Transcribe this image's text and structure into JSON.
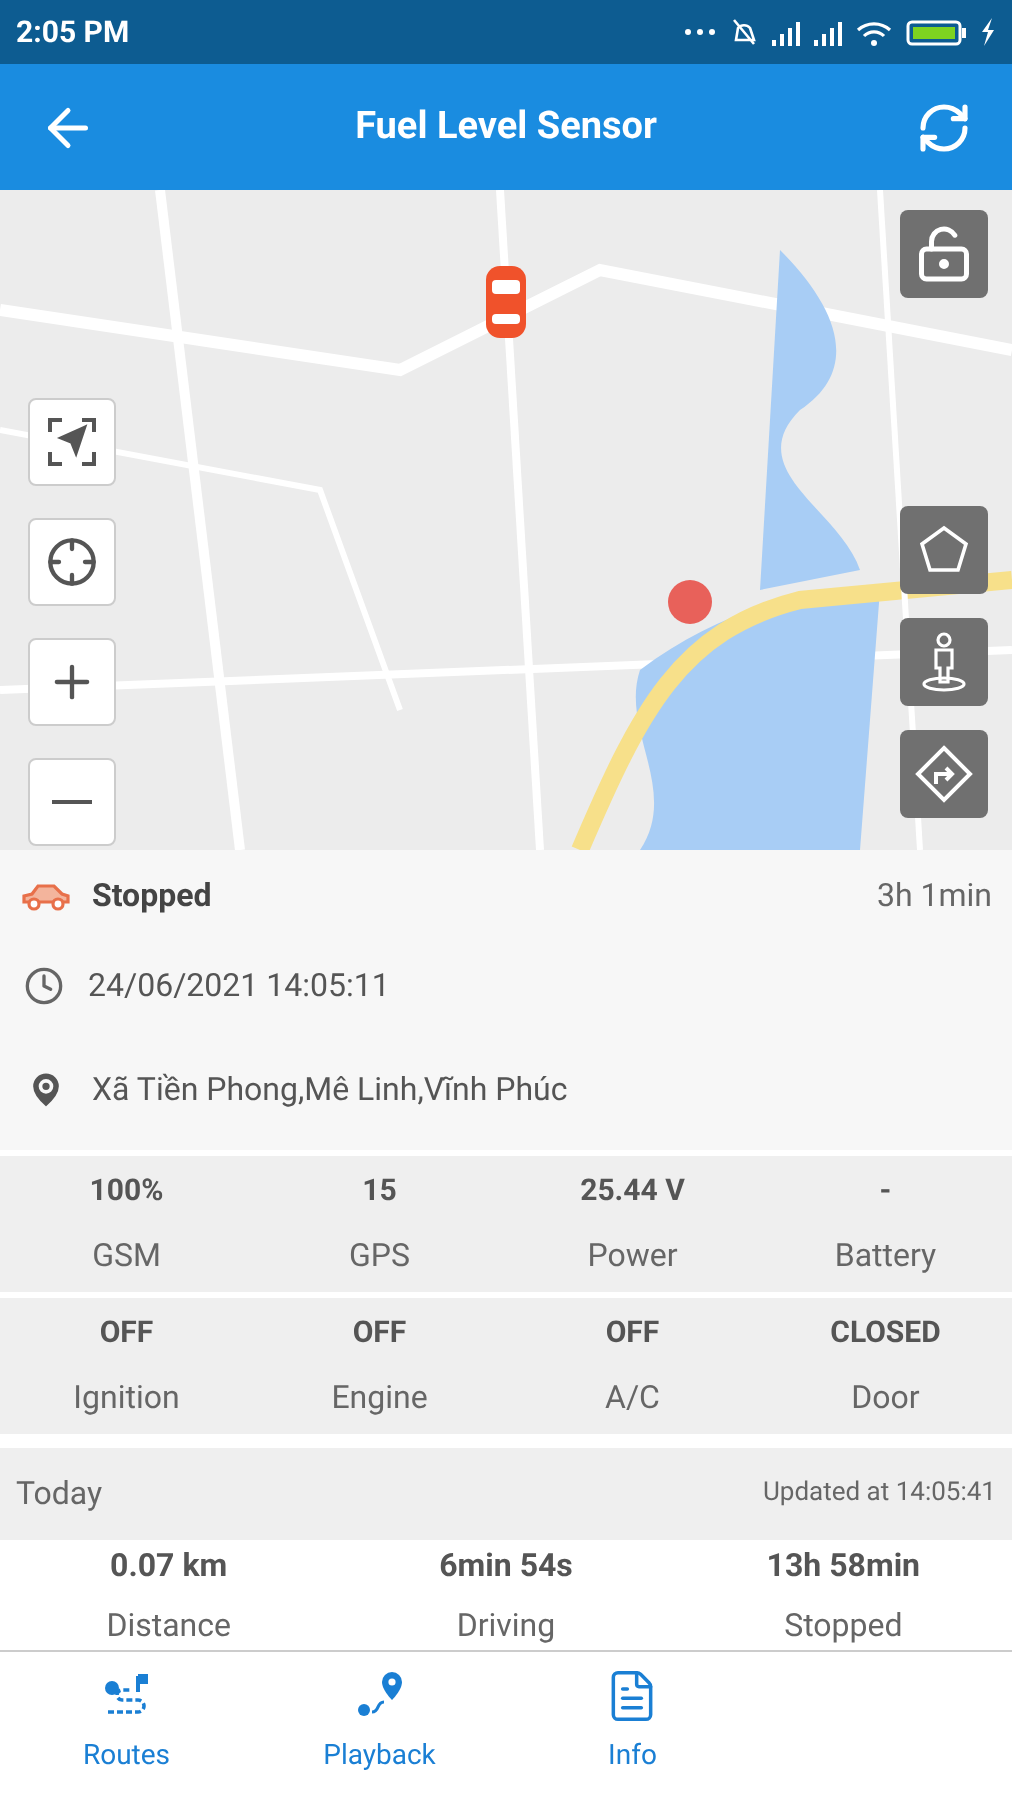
{
  "status_bar": {
    "time": "2:05 PM"
  },
  "app_bar": {
    "title": "Fuel Level Sensor"
  },
  "vehicle": {
    "status": "Stopped",
    "duration": "3h 1min",
    "timestamp": "24/06/2021 14:05:11",
    "address": "Xã Tiền Phong,Mê Linh,Vĩnh Phúc"
  },
  "sensors": [
    {
      "value": "100%",
      "label": "GSM"
    },
    {
      "value": "15",
      "label": "GPS"
    },
    {
      "value": "25.44 V",
      "label": "Power"
    },
    {
      "value": "-",
      "label": "Battery"
    },
    {
      "value": "OFF",
      "label": "Ignition"
    },
    {
      "value": "OFF",
      "label": "Engine"
    },
    {
      "value": "OFF",
      "label": "A/C"
    },
    {
      "value": "CLOSED",
      "label": "Door"
    }
  ],
  "today": {
    "label": "Today",
    "updated": "Updated at 14:05:41",
    "stats": [
      {
        "value": "0.07 km",
        "label": "Distance"
      },
      {
        "value": "6min 54s",
        "label": "Driving"
      },
      {
        "value": "13h 58min",
        "label": "Stopped"
      }
    ]
  },
  "bottom_nav": [
    {
      "kind": "routes",
      "label": "Routes"
    },
    {
      "kind": "playback",
      "label": "Playback"
    },
    {
      "kind": "info",
      "label": "Info"
    }
  ]
}
